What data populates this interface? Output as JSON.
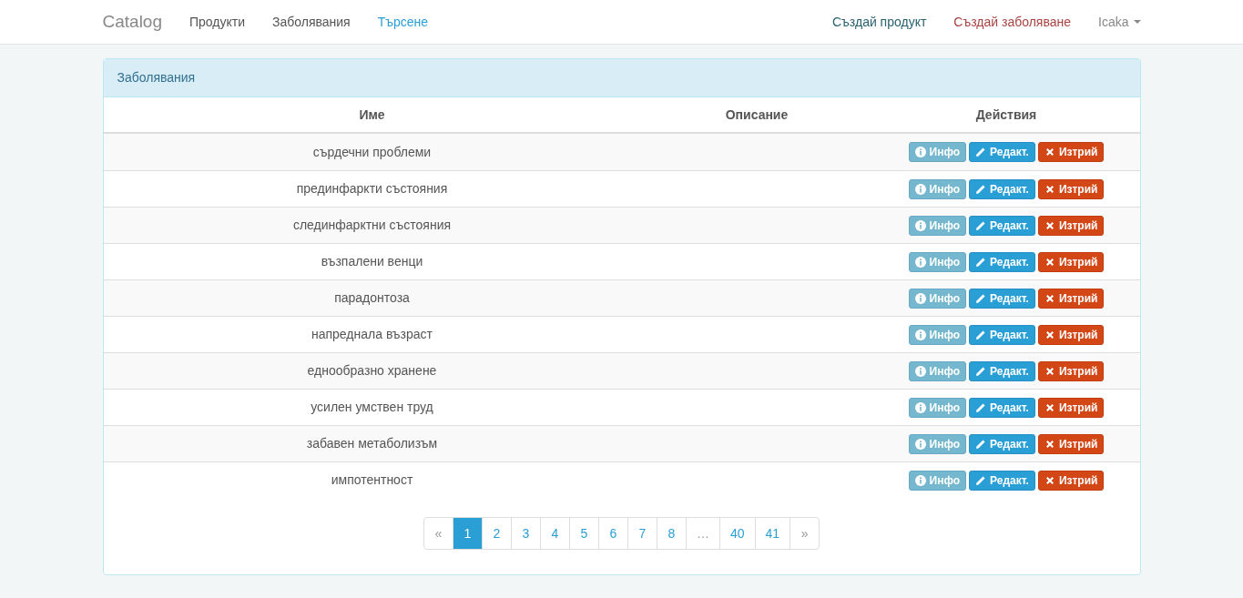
{
  "navbar": {
    "brand": "Catalog",
    "left_links": [
      {
        "label": "Продукти",
        "color": "#555555"
      },
      {
        "label": "Заболявания",
        "color": "#555555"
      },
      {
        "label": "Търсене",
        "color": "#2a9fd6"
      }
    ],
    "right_links": [
      {
        "label": "Създай продукт",
        "color": "#28626f"
      },
      {
        "label": "Създай заболяване",
        "color": "#a94442"
      }
    ],
    "user_menu": {
      "label": "Icaka"
    }
  },
  "panel": {
    "title": "Заболявания",
    "table": {
      "columns": [
        "Име",
        "Описание",
        "Действия"
      ],
      "rows": [
        {
          "name": "сърдечни проблеми",
          "actions": [
            {
              "kind": "info",
              "label": "Инфо"
            },
            {
              "kind": "edit",
              "label": "Редакт."
            },
            {
              "kind": "delete",
              "label": "Изтрий"
            }
          ]
        },
        {
          "name": "прединфаркти състояния",
          "actions": [
            {
              "kind": "info",
              "label": "Инфо"
            },
            {
              "kind": "edit",
              "label": "Редакт."
            },
            {
              "kind": "delete",
              "label": "Изтрий"
            }
          ]
        },
        {
          "name": "слединфарктни състояния",
          "actions": [
            {
              "kind": "info",
              "label": "Инфо"
            },
            {
              "kind": "edit",
              "label": "Редакт."
            },
            {
              "kind": "delete",
              "label": "Изтрий"
            }
          ]
        },
        {
          "name": "възпалени венци",
          "actions": [
            {
              "kind": "info",
              "label": "Инфо"
            },
            {
              "kind": "edit",
              "label": "Редакт."
            },
            {
              "kind": "delete",
              "label": "Изтрий"
            }
          ]
        },
        {
          "name": "парадонтоза",
          "actions": [
            {
              "kind": "info",
              "label": "Инфо"
            },
            {
              "kind": "edit",
              "label": "Редакт."
            },
            {
              "kind": "delete",
              "label": "Изтрий"
            }
          ]
        },
        {
          "name": "напреднала възраст",
          "actions": [
            {
              "kind": "info",
              "label": "Инфо"
            },
            {
              "kind": "edit",
              "label": "Редакт."
            },
            {
              "kind": "delete",
              "label": "Изтрий"
            }
          ]
        },
        {
          "name": "еднообразно хранене",
          "actions": [
            {
              "kind": "info",
              "label": "Инфо"
            },
            {
              "kind": "edit",
              "label": "Редакт."
            },
            {
              "kind": "delete",
              "label": "Изтрий"
            }
          ]
        },
        {
          "name": "усилен умствен труд",
          "actions": [
            {
              "kind": "info",
              "label": "Инфо"
            },
            {
              "kind": "edit",
              "label": "Редакт."
            },
            {
              "kind": "delete",
              "label": "Изтрий"
            }
          ]
        },
        {
          "name": "забавен метаболизъм",
          "actions": [
            {
              "kind": "info",
              "label": "Инфо"
            },
            {
              "kind": "edit",
              "label": "Редакт."
            },
            {
              "kind": "delete",
              "label": "Изтрий"
            }
          ]
        },
        {
          "name": "импотентност",
          "actions": [
            {
              "kind": "info",
              "label": "Инфо"
            },
            {
              "kind": "edit",
              "label": "Редакт."
            },
            {
              "kind": "delete",
              "label": "Изтрий"
            }
          ]
        }
      ]
    },
    "pagination": [
      {
        "kind": "arrow",
        "label": "«",
        "selected": false
      },
      {
        "kind": "page",
        "label": "1",
        "selected": true
      },
      {
        "kind": "page",
        "label": "2",
        "selected": false
      },
      {
        "kind": "page",
        "label": "3",
        "selected": false
      },
      {
        "kind": "page",
        "label": "4",
        "selected": false
      },
      {
        "kind": "page",
        "label": "5",
        "selected": false
      },
      {
        "kind": "page",
        "label": "6",
        "selected": false
      },
      {
        "kind": "page",
        "label": "7",
        "selected": false
      },
      {
        "kind": "page",
        "label": "8",
        "selected": false
      },
      {
        "kind": "ellipsis",
        "label": "…",
        "selected": false
      },
      {
        "kind": "page",
        "label": "40",
        "selected": false
      },
      {
        "kind": "page",
        "label": "41",
        "selected": false
      },
      {
        "kind": "arrow",
        "label": "»",
        "selected": false
      }
    ]
  }
}
